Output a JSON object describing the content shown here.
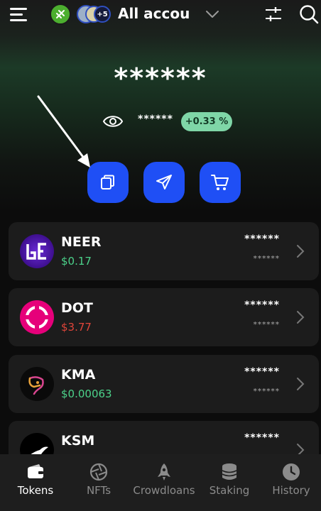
{
  "header": {
    "account_title": "All accou",
    "more_accounts_badge": "+5",
    "icons": [
      "menu-icon",
      "account-avatar",
      "chevron-down-icon",
      "sliders-icon",
      "search-icon"
    ]
  },
  "balance": {
    "total": "******",
    "sub_total": "******",
    "change_percent": "+0.33 %"
  },
  "actions": [
    {
      "name": "copy-address",
      "icon": "copy-icon"
    },
    {
      "name": "send",
      "icon": "paper-plane-icon"
    },
    {
      "name": "buy",
      "icon": "cart-icon"
    }
  ],
  "tokens": [
    {
      "symbol": "NEER",
      "price": "$0.17",
      "trend": "up",
      "value": "******",
      "sub_value": "******"
    },
    {
      "symbol": "DOT",
      "price": "$3.77",
      "trend": "down",
      "value": "******",
      "sub_value": "******"
    },
    {
      "symbol": "KMA",
      "price": "$0.00063",
      "trend": "up",
      "value": "******",
      "sub_value": "******"
    },
    {
      "symbol": "KSM",
      "price": "",
      "trend": "up",
      "value": "******",
      "sub_value": ""
    }
  ],
  "nav": {
    "items": [
      {
        "label": "Tokens",
        "icon": "wallet-icon",
        "active": true
      },
      {
        "label": "NFTs",
        "icon": "aperture-icon",
        "active": false
      },
      {
        "label": "Crowdloans",
        "icon": "rocket-icon",
        "active": false
      },
      {
        "label": "Staking",
        "icon": "database-icon",
        "active": false
      },
      {
        "label": "History",
        "icon": "clock-icon",
        "active": false
      }
    ]
  },
  "colors": {
    "accent": "#1f4ff5",
    "positive": "#4cd28a",
    "negative": "#e0453a",
    "badge_bg": "#7fd6a7",
    "card_bg": "#1c1c1c"
  }
}
